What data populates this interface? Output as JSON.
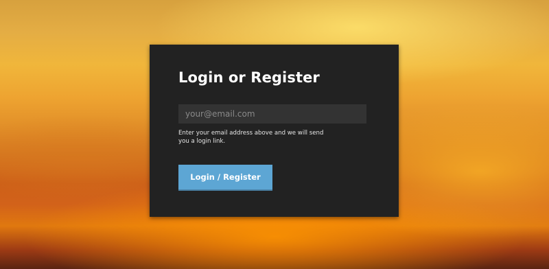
{
  "login": {
    "title": "Login or Register",
    "email_placeholder": "your@email.com",
    "email_value": "",
    "hint": "Enter your email address above and we will send you a login link.",
    "submit_label": "Login / Register"
  },
  "colors": {
    "card_background": "#222222",
    "input_background": "#333333",
    "button_background": "#5da6d4",
    "button_text": "#ffffff",
    "background_top": "#d7a13e",
    "background_bottom": "#5a2412"
  }
}
